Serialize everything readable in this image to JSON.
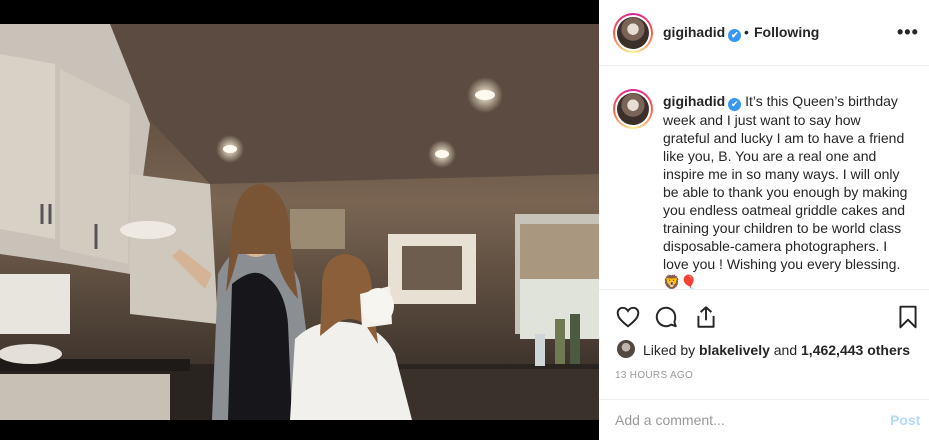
{
  "post": {
    "username": "gigihadid",
    "verified_mark": "✔",
    "dot": "•",
    "following_label": "Following",
    "more_label": "•••",
    "caption_username": "gigihadid",
    "caption_text": "It’s this Queen’s birthday week and I just want to say how grateful and lucky I am to have a friend like you, B. You are a real one and inspire me in so many ways. I will only be able to thank you enough by making you endless oatmeal griddle cakes and training your children to be world class disposable-camera photographers. I love you ! Wishing you every blessing. 🦁🎈",
    "photo_alt": "Two women in a kitchen, one holding a bowl, one drinking from a mug"
  },
  "actions": {
    "like_icon": "heart-icon",
    "comment_icon": "speech-bubble-icon",
    "share_icon": "share-icon",
    "save_icon": "bookmark-icon",
    "liked_by_prefix": "Liked by",
    "liked_by_user": "blakelively",
    "liked_by_and": "and",
    "liked_count": "1,462,443 others",
    "timestamp": "13 HOURS AGO"
  },
  "comment_box": {
    "placeholder": "Add a comment...",
    "post_label": "Post"
  },
  "colors": {
    "verified": "#3897f0",
    "post_disabled": "#b3dbff",
    "muted": "#999999"
  }
}
